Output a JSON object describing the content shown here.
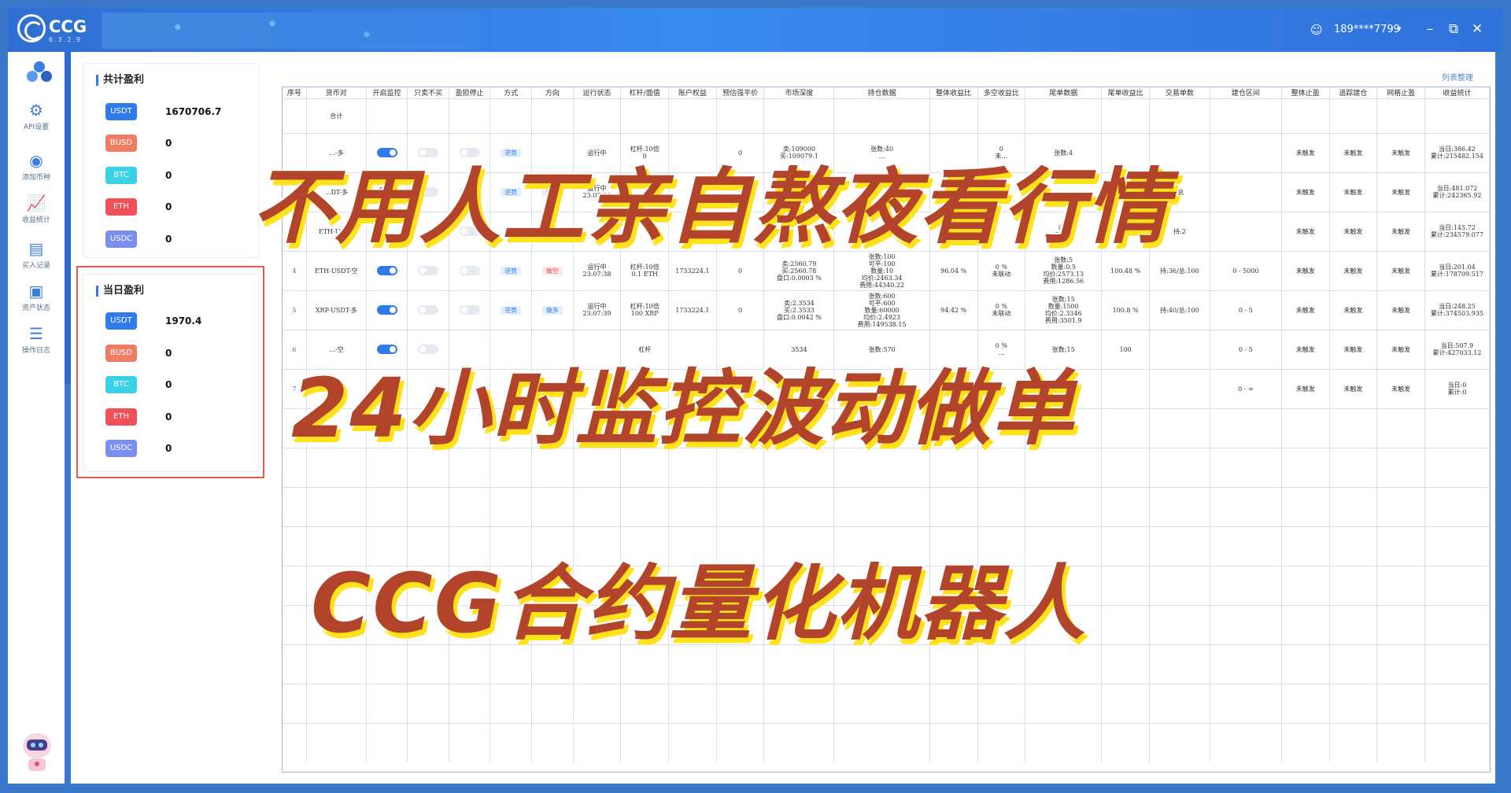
{
  "app": {
    "name": "CCG",
    "version": "6.3.2.9",
    "user": "189****7799"
  },
  "window_controls": {
    "minimize": "–",
    "maximize": "⧉",
    "close": "✕"
  },
  "sidebar": [
    {
      "label": "API设置",
      "icon": "gear-icon"
    },
    {
      "label": "添加币种",
      "icon": "coin-add-icon"
    },
    {
      "label": "收益统计",
      "icon": "chart-icon"
    },
    {
      "label": "买入记录",
      "icon": "record-icon"
    },
    {
      "label": "资产状态",
      "icon": "wallet-icon"
    },
    {
      "label": "操作日志",
      "icon": "log-icon"
    }
  ],
  "total_profit": {
    "title": "共计盈利",
    "rows": [
      {
        "coin": "USDT",
        "value": "1670706.7",
        "color": "#2f7bea"
      },
      {
        "coin": "BUSD",
        "value": "0",
        "color": "#f07c63"
      },
      {
        "coin": "BTC",
        "value": "0",
        "color": "#38d1e6"
      },
      {
        "coin": "ETH",
        "value": "0",
        "color": "#f0505a"
      },
      {
        "coin": "USDC",
        "value": "0",
        "color": "#7b8ff0"
      }
    ]
  },
  "daily_profit": {
    "title": "当日盈利",
    "rows": [
      {
        "coin": "USDT",
        "value": "1970.4",
        "color": "#2f7bea"
      },
      {
        "coin": "BUSD",
        "value": "0",
        "color": "#f07c63"
      },
      {
        "coin": "BTC",
        "value": "0",
        "color": "#38d1e6"
      },
      {
        "coin": "ETH",
        "value": "0",
        "color": "#f0505a"
      },
      {
        "coin": "USDC",
        "value": "0",
        "color": "#7b8ff0"
      }
    ]
  },
  "table": {
    "list_link": "列表整理",
    "headers": [
      "序号",
      "货币对",
      "开启监控",
      "只卖不买",
      "盈损停止",
      "方式",
      "方向",
      "运行状态",
      "杠杆/面值",
      "账户权益",
      "预估强平价",
      "市场深度",
      "持仓数据",
      "整体收益比",
      "多空收益比",
      "尾单数据",
      "尾单收益比",
      "交易单数",
      "建仓区间",
      "整体止盈",
      "追踪建仓",
      "网格止盈",
      "收益统计"
    ],
    "summary_label": "合计",
    "rows": [
      {
        "idx": "",
        "pair": "…-多",
        "monitor": "on",
        "sellonly": "off",
        "stop": "off",
        "mode": "逆势",
        "dir": "",
        "status": "运行中",
        "lever": "杠杆:10倍\n0",
        "equity": "",
        "liq": "0",
        "depth": "卖:109000\n买:109079.1",
        "hold": "张数:40\n…",
        "total": "",
        "ls": "0\n未…",
        "tail": "张数:4",
        "tailr": "",
        "trades": "",
        "range": "",
        "tp": "未触发",
        "track": "未触发",
        "grid": "未触发",
        "stat": "当日:386.42\n累计:215482.154"
      },
      {
        "idx": "",
        "pair": "…DT-多",
        "monitor": "on",
        "sellonly": "off",
        "stop": "off",
        "mode": "逆势",
        "dir": "做空",
        "status": "运行中\n23:07:39",
        "lever": "",
        "equity": "",
        "liq": "",
        "depth": "",
        "hold": "",
        "total": "",
        "ls": "",
        "tail": "",
        "tailr": "",
        "trades": "/总",
        "range": "",
        "tp": "未触发",
        "track": "未触发",
        "grid": "未触发",
        "stat": "当日:481.072\n累计:242365.92"
      },
      {
        "idx": "",
        "pair": "ETH-USDT",
        "monitor": "",
        "sellonly": "",
        "stop": "off",
        "mode": "",
        "dir": "",
        "status": "",
        "lever": "",
        "equity": "",
        "liq": "",
        "depth": "",
        "hold": "",
        "total": "",
        "ls": "",
        "tail": "0.8\n2544",
        "tailr": "100",
        "trades": "持:2",
        "range": "",
        "tp": "未触发",
        "track": "未触发",
        "grid": "未触发",
        "stat": "当日:145.72\n累计:234579.077"
      },
      {
        "idx": "4",
        "pair": "ETH-USDT-空",
        "monitor": "on",
        "sellonly": "off",
        "stop": "off",
        "mode": "逆势",
        "dir": "做空",
        "status": "运行中\n23:07:38",
        "lever": "杠杆:10倍\n0.1 ETH",
        "equity": "1733224.1",
        "liq": "0",
        "depth": "卖:2560.79\n买:2560.78\n盘口:0.0003 %",
        "hold": "张数:100\n可平:100\n数量:10\n均价:2463.34\n费用:44340.22",
        "total": "96.04 %",
        "ls": "0 %\n未联动",
        "tail": "张数:5\n数量:0.5\n均价:2573.13\n费用:1286.56",
        "tailr": "100.48 %",
        "trades": "持:36/总:100",
        "range": "0 - 5000",
        "tp": "未触发",
        "track": "未触发",
        "grid": "未触发",
        "stat": "当日:201.04\n累计:178709.517"
      },
      {
        "idx": "5",
        "pair": "XRP-USDT-多",
        "monitor": "on",
        "sellonly": "off",
        "stop": "off",
        "mode": "逆势",
        "dir": "做多",
        "status": "运行中\n23:07:39",
        "lever": "杠杆:10倍\n100 XRP",
        "equity": "1733224.1",
        "liq": "0",
        "depth": "卖:2.3534\n买:2.3533\n盘口:0.0042 %",
        "hold": "张数:600\n可平:600\n数量:60000\n均价:2.4923\n费用:149538.15",
        "total": "94.42 %",
        "ls": "0 %\n未联动",
        "tail": "张数:15\n数量:1500\n均价:2.3346\n费用:3501.9",
        "tailr": "100.8 %",
        "trades": "持:40/总:100",
        "range": "0 - 5",
        "tp": "未触发",
        "track": "未触发",
        "grid": "未触发",
        "stat": "当日:248.25\n累计:374503.935"
      },
      {
        "idx": "6",
        "pair": "…-空",
        "monitor": "on",
        "sellonly": "off",
        "stop": "",
        "mode": "",
        "dir": "",
        "status": "",
        "lever": "杠杆",
        "equity": "",
        "liq": "",
        "depth": "3534",
        "hold": "张数:570",
        "total": "",
        "ls": "0 %\n…",
        "tail": "张数:15",
        "tailr": "100",
        "trades": "",
        "range": "0 - 5",
        "tp": "未触发",
        "track": "未触发",
        "grid": "未触发",
        "stat": "当日:507.9\n累计:427033.12"
      },
      {
        "idx": "7",
        "pair": "",
        "monitor": "",
        "sellonly": "",
        "stop": "",
        "mode": "",
        "dir": "",
        "status": "",
        "lever": "",
        "equity": "",
        "liq": "",
        "depth": "",
        "hold": "",
        "total": "",
        "ls": "",
        "tail": "",
        "tailr": "",
        "trades": "",
        "range": "0 - ∞",
        "tp": "未触发",
        "track": "未触发",
        "grid": "未触发",
        "stat": "当日:0\n累计:0"
      }
    ]
  },
  "overlay": {
    "line1": "不用人工亲自熬夜看行情",
    "line2": "24小时监控波动做单",
    "line3": "CCG合约量化机器人"
  }
}
